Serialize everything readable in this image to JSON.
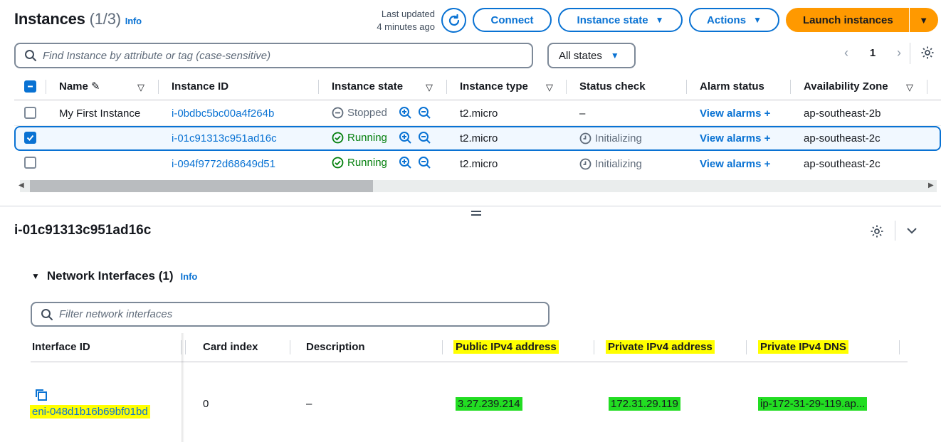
{
  "header": {
    "title": "Instances",
    "count": "(1/3)",
    "info": "Info",
    "last_updated_line1": "Last updated",
    "last_updated_line2": "4 minutes ago",
    "connect": "Connect",
    "instance_state": "Instance state",
    "actions": "Actions",
    "launch": "Launch instances"
  },
  "filter": {
    "placeholder": "Find Instance by attribute or tag (case-sensitive)",
    "states": "All states",
    "page": "1"
  },
  "columns": [
    "Name",
    "Instance ID",
    "Instance state",
    "Instance type",
    "Status check",
    "Alarm status",
    "Availability Zone"
  ],
  "rows": [
    {
      "name": "My First Instance",
      "id": "i-0bdbc5bc00a4f264b",
      "state": "Stopped",
      "type": "t2.micro",
      "status": "–",
      "alarm": "View alarms",
      "az": "ap-southeast-2b",
      "selected": false
    },
    {
      "name": "",
      "id": "i-01c91313c951ad16c",
      "state": "Running",
      "type": "t2.micro",
      "status": "Initializing",
      "alarm": "View alarms",
      "az": "ap-southeast-2c",
      "selected": true
    },
    {
      "name": "",
      "id": "i-094f9772d68649d51",
      "state": "Running",
      "type": "t2.micro",
      "status": "Initializing",
      "alarm": "View alarms",
      "az": "ap-southeast-2c",
      "selected": false
    }
  ],
  "detail": {
    "title": "i-01c91313c951ad16c",
    "section_title": "Network Interfaces (1)",
    "info": "Info",
    "filter_placeholder": "Filter network interfaces",
    "columns": [
      "Interface ID",
      "Card index",
      "Description",
      "Public IPv4 address",
      "Private IPv4 address",
      "Private IPv4 DNS"
    ],
    "row": {
      "interface_id": "eni-048d1b16b69bf01bd",
      "card_index": "0",
      "description": "–",
      "public_ip": "3.27.239.214",
      "private_ip": "172.31.29.119",
      "private_dns": "ip-172-31-29-119.ap..."
    }
  },
  "colors": {
    "accent": "#0972d3",
    "launch": "#ff9900",
    "running": "#037f0c",
    "highlight_yellow": "#ffff00",
    "highlight_green": "#22dd22"
  }
}
